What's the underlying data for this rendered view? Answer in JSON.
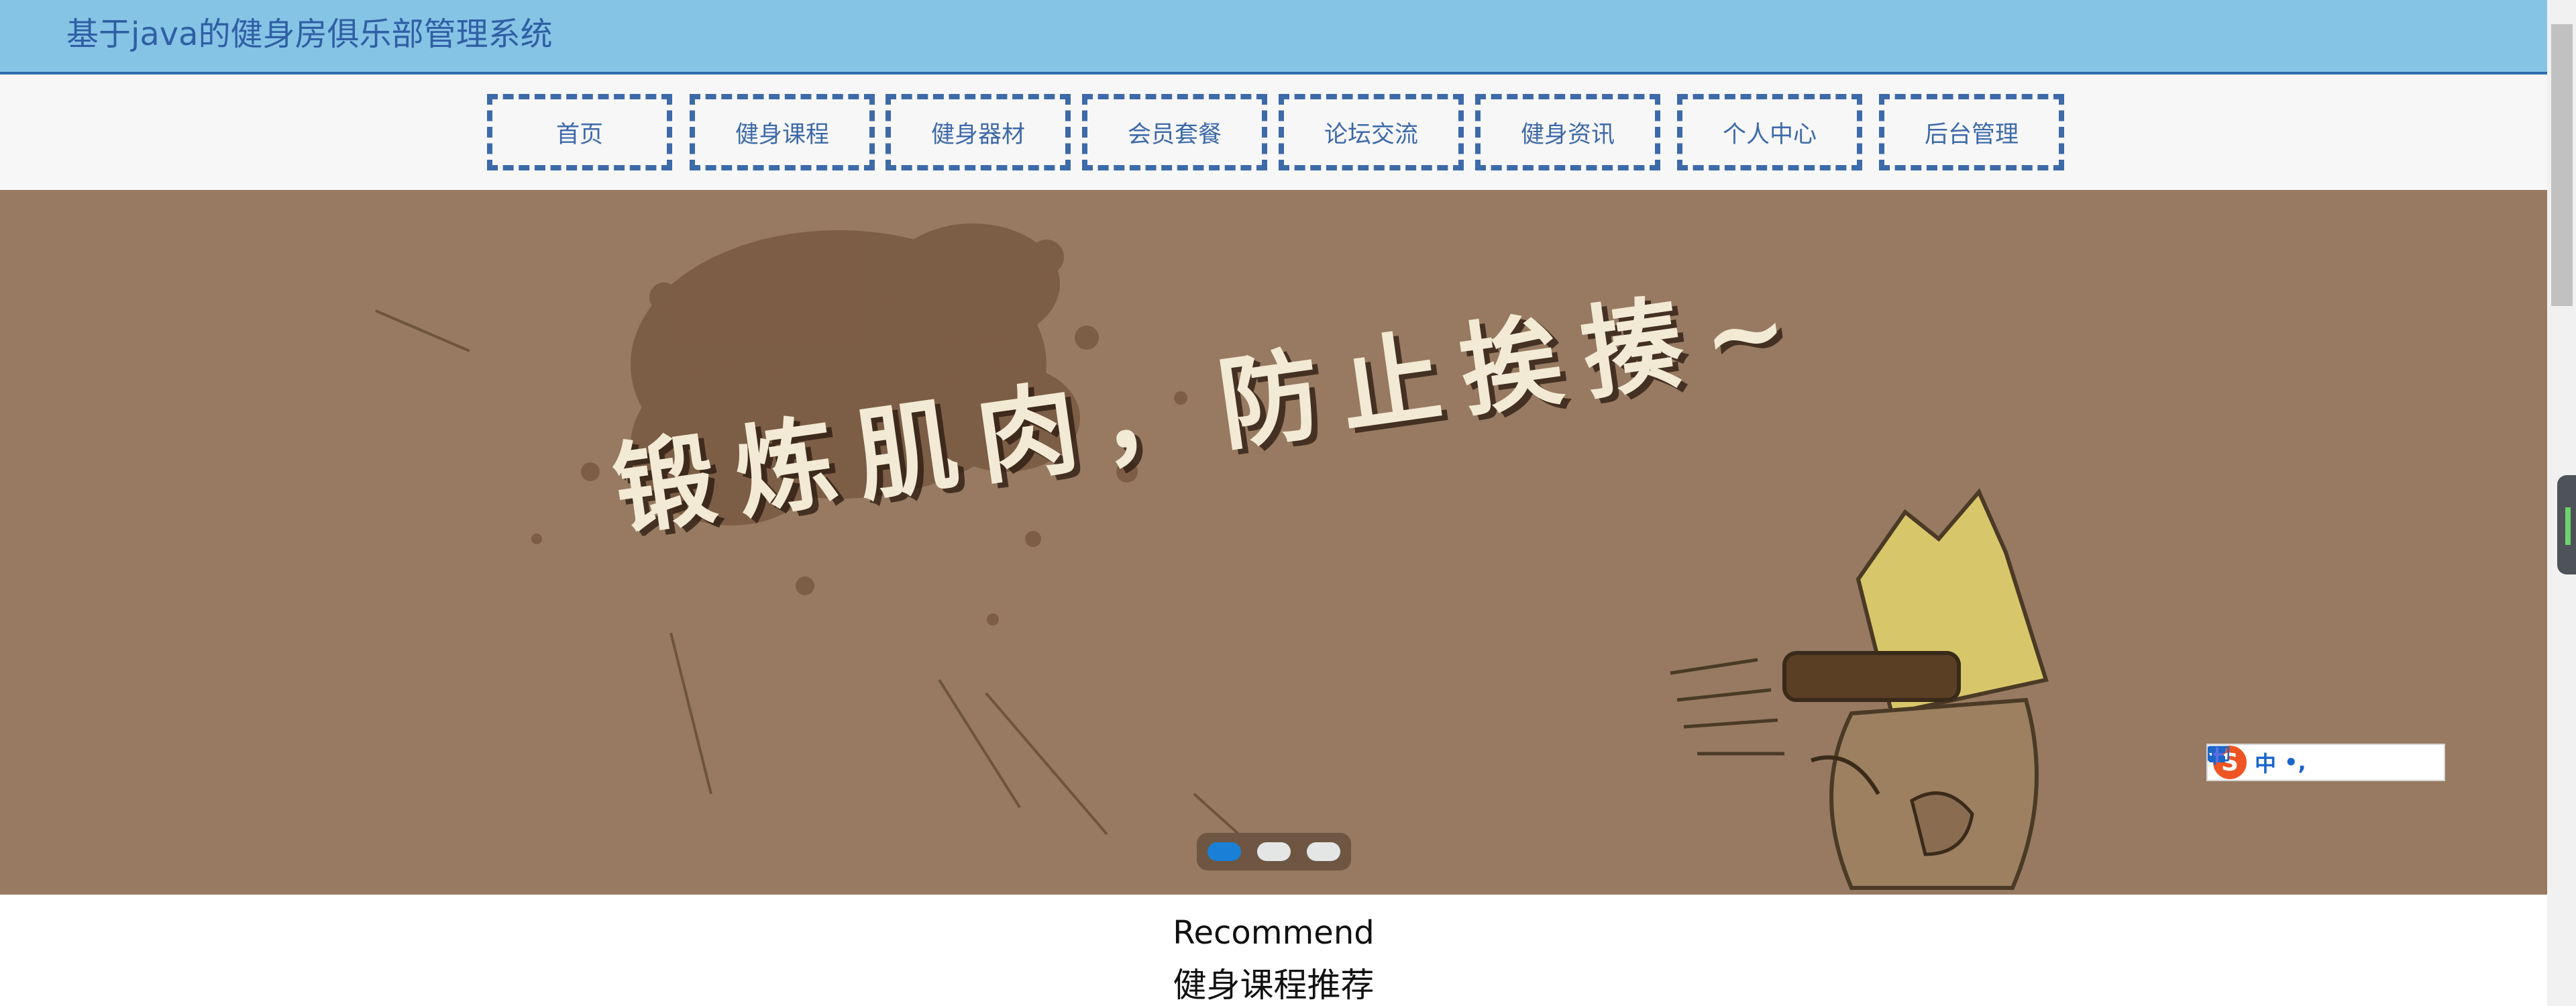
{
  "header": {
    "title": "基于java的健身房俱乐部管理系统"
  },
  "nav": {
    "items": [
      {
        "label": "首页"
      },
      {
        "label": "健身课程"
      },
      {
        "label": "健身器材"
      },
      {
        "label": "会员套餐"
      },
      {
        "label": "论坛交流"
      },
      {
        "label": "健身资讯"
      },
      {
        "label": "个人中心"
      },
      {
        "label": "后台管理"
      }
    ]
  },
  "banner": {
    "slogan": "锻炼肌肉，防止挨揍~",
    "active_slide": 1,
    "slide_count": 3
  },
  "ime": {
    "logo": "S",
    "language": "中",
    "punct": "•,",
    "icons": [
      "microphone-icon",
      "keyboard-icon",
      "skin-icon",
      "grid-icon"
    ]
  },
  "recommend": {
    "title_en": "Recommend",
    "title_cn": "健身课程推荐"
  },
  "colors": {
    "header_bg": "#86c4e6",
    "accent": "#3d6aa8",
    "banner_bg": "#977a61",
    "active_dot": "#1a7fd6"
  }
}
